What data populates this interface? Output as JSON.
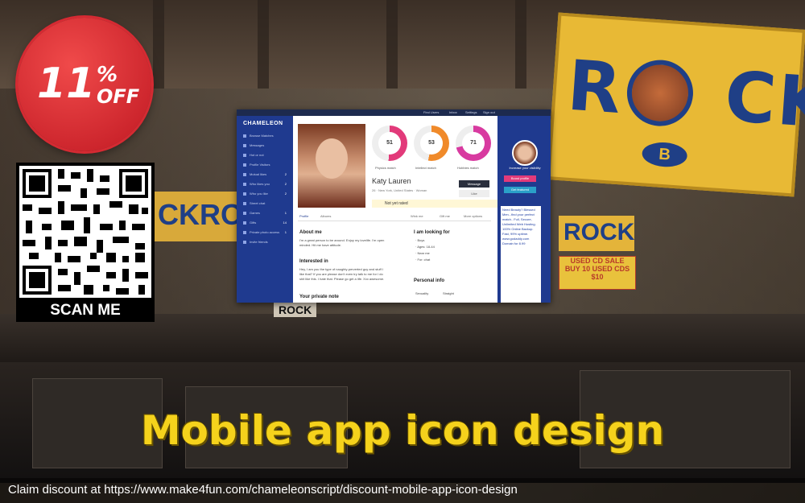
{
  "badge": {
    "percent": "11",
    "percent_sign": "%",
    "off": "OFF"
  },
  "qr": {
    "label": "SCAN ME"
  },
  "screenshot": {
    "logo": "CHAMELEON",
    "topbar": [
      "Find Users",
      "Inbox",
      "Settings",
      "Sign out"
    ],
    "nav": [
      {
        "label": "Browse Matches",
        "count": ""
      },
      {
        "label": "Messages",
        "count": ""
      },
      {
        "label": "Hot or not",
        "count": ""
      },
      {
        "label": "Profile Visitors",
        "count": ""
      },
      {
        "label": "Mutual likes",
        "count": "2"
      },
      {
        "label": "Who likes you",
        "count": "2"
      },
      {
        "label": "Who you like",
        "count": "2"
      },
      {
        "label": "Street chat",
        "count": ""
      },
      {
        "label": "Games",
        "count": "1"
      },
      {
        "label": "Gifts",
        "count": "14"
      },
      {
        "label": "Private photo access",
        "count": "1"
      },
      {
        "label": "Invite friends",
        "count": ""
      }
    ],
    "matches": [
      {
        "value": "51",
        "label": "Physics match",
        "color": "#e23a7a"
      },
      {
        "value": "53",
        "label": "Intellect match",
        "color": "#f08a2a"
      },
      {
        "value": "71",
        "label": "Hobbies match",
        "color": "#d83aa0"
      }
    ],
    "profile": {
      "name": "Katy Lauren",
      "details": "26 · New York, United States · Woman",
      "message_btn": "Message",
      "like_btn": "Like",
      "rated": "Not yet rated",
      "tabs": [
        "Profile",
        "Albums",
        "Wink me",
        "Gift me",
        "More options"
      ],
      "about_title": "About me",
      "about_text": "I'm a great person to be around. Enjoy my lovelife. I'm open minded. Hit me have attitude.",
      "interested_title": "Interested in",
      "interested_text": "Hey, I am you the type of naughty-perverted guy and stuff I like that? If you are please don't even try talk to me for I do shit like this. I hate that. Please go get a life. Xxx awesome.",
      "private_title": "Your private note",
      "looking_title": "I am looking for",
      "looking_items": [
        "· Boys",
        "· Ages: 18-44",
        "· Near me",
        "· For: chat"
      ],
      "personal_title": "Personal info",
      "personal_row": [
        "Sexuality",
        "Straight"
      ]
    },
    "right": {
      "increase": "Increase your visibility",
      "boost": "Boost profile",
      "featured": "Get featured",
      "ad_text": "Need Beauty? Blessed Men...find your perfect match.. Full, Secure, Unlimited Web Hosting. 100% Online Backup. Fast, 99% uptime. www.godaddy.com Domain for 8.99"
    },
    "colors": {
      "nav": "#1f3a8f",
      "topbar": "#1d2a4e"
    }
  },
  "title": "Mobile app icon design",
  "footer": "Claim discount at https://www.make4fun.com/chameleonscript/discount-mobile-app-icon-design"
}
